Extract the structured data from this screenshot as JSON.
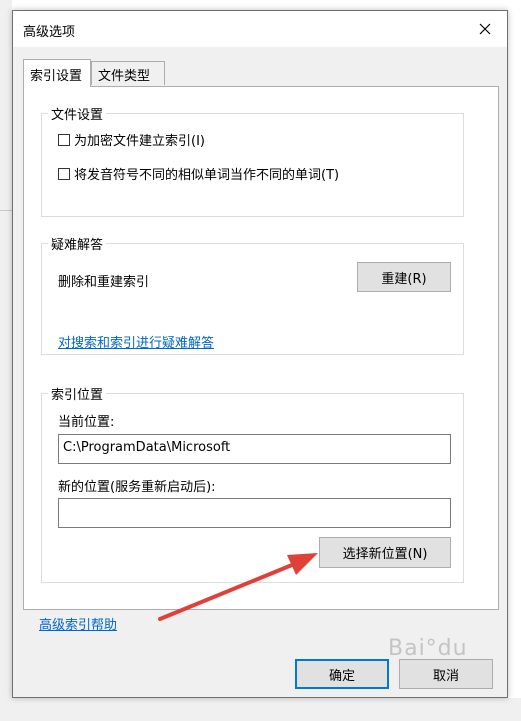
{
  "dialog": {
    "title": "高级选项"
  },
  "tabs": [
    {
      "label": "索引设置",
      "active": true
    },
    {
      "label": "文件类型",
      "active": false
    }
  ],
  "file_settings": {
    "title": "文件设置",
    "checkboxes": [
      {
        "label": "为加密文件建立索引(I)",
        "checked": false
      },
      {
        "label": "将发音符号不同的相似单词当作不同的单词(T)",
        "checked": false
      }
    ]
  },
  "troubleshoot": {
    "title": "疑难解答",
    "delete_rebuild_label": "删除和重建索引",
    "rebuild_button": "重建(R)",
    "troubleshoot_link": "对搜索和索引进行疑难解答"
  },
  "index_location": {
    "title": "索引位置",
    "current_label": "当前位置:",
    "current_value": "C:\\ProgramData\\Microsoft",
    "new_label": "新的位置(服务重新启动后):",
    "new_value": "",
    "select_button": "选择新位置(N)"
  },
  "help_link": "高级索引帮助",
  "footer": {
    "ok_button": "确定",
    "cancel_button": "取消"
  },
  "colors": {
    "accent": "#0078d7",
    "link": "#0066cc",
    "arrow": "#e0403a"
  }
}
